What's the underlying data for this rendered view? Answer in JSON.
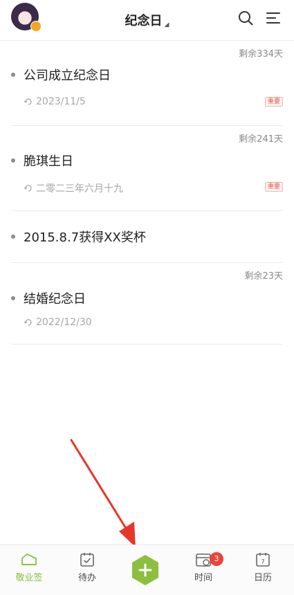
{
  "header": {
    "title": "纪念日",
    "caret": "◢"
  },
  "items": [
    {
      "remaining": "剩余334天",
      "name": "公司成立纪念日",
      "date": "2023/11/5",
      "tag": "重要"
    },
    {
      "remaining": "剩余241天",
      "name": "脆琪生日",
      "date": "二零二三年六月十九",
      "tag": "重要"
    },
    {
      "name": "2015.8.7获得XX奖杯"
    },
    {
      "remaining": "剩余23天",
      "name": "结婚纪念日",
      "date": "2022/12/30"
    }
  ],
  "bottom_nav": {
    "items": [
      {
        "label": "敬业签",
        "icon": "note-icon"
      },
      {
        "label": "待办",
        "icon": "todo-calendar-icon"
      },
      {
        "label": "",
        "icon": "plus-icon"
      },
      {
        "label": "时间",
        "icon": "time-calendar-icon"
      },
      {
        "label": "日历",
        "icon": "calendar-icon"
      }
    ],
    "badge_count": "3",
    "calendar_day": "7"
  },
  "colors": {
    "accent_green": "#8cbf3f",
    "tag_red": "#e8564a",
    "arrow_red": "#e8352b"
  }
}
